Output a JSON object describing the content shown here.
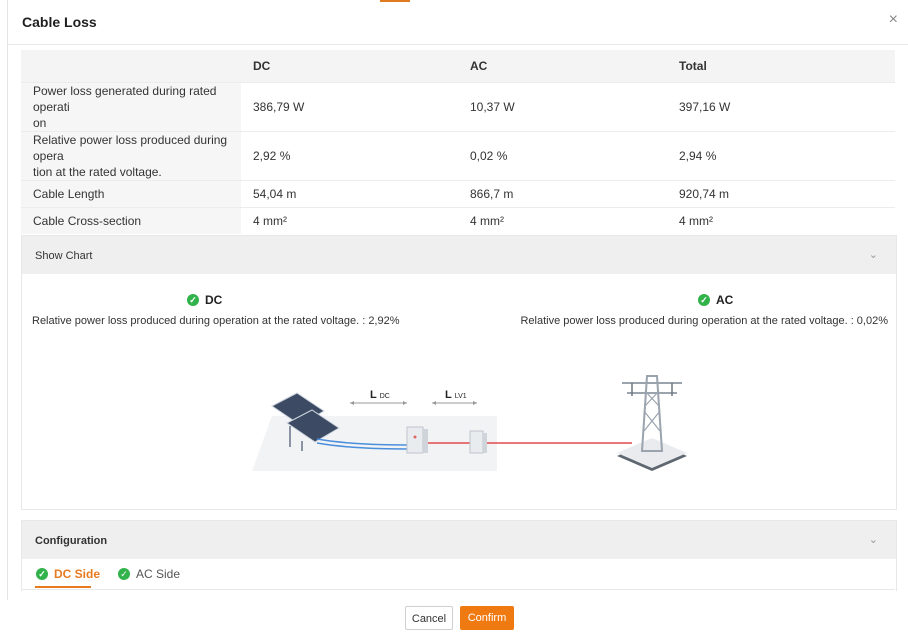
{
  "dialog": {
    "title": "Cable Loss",
    "close_icon": "×"
  },
  "table": {
    "headers": [
      "",
      "DC",
      "AC",
      "Total"
    ],
    "rows": [
      {
        "label": "Power loss generated during rated operati\non",
        "dc": "386,79 W",
        "ac": "10,37 W",
        "total": "397,16 W"
      },
      {
        "label": "Relative power loss produced during opera\ntion at the rated voltage.",
        "dc": "2,92 %",
        "ac": "0,02 %",
        "total": "2,94 %"
      },
      {
        "label": "Cable Length",
        "dc": "54,04 m",
        "ac": "866,7 m",
        "total": "920,74 m"
      },
      {
        "label": "Cable Cross-section",
        "dc": "4 mm²",
        "ac": "4 mm²",
        "total": "4 mm²"
      }
    ]
  },
  "chart_panel": {
    "title": "Show Chart",
    "chevron": "⌄",
    "dc_label": "DC",
    "dc_desc": "Relative power loss produced during operation at the rated voltage. : 2,92%",
    "ac_label": "AC",
    "ac_desc": "Relative power loss produced during operation at the rated voltage. : 0,02%",
    "diagram": {
      "l_dc": "L",
      "l_dc_sub": "DC",
      "l_lv": "L",
      "l_lv_sub": "LV1"
    }
  },
  "config_panel": {
    "title": "Configuration",
    "chevron": "⌄",
    "tabs": [
      {
        "label": "DC Side",
        "active": true
      },
      {
        "label": "AC Side",
        "active": false
      }
    ]
  },
  "footer": {
    "cancel": "Cancel",
    "confirm": "Confirm"
  },
  "colors": {
    "accent": "#f07a12",
    "success": "#32b24a"
  },
  "icons": {
    "check": "✓"
  }
}
